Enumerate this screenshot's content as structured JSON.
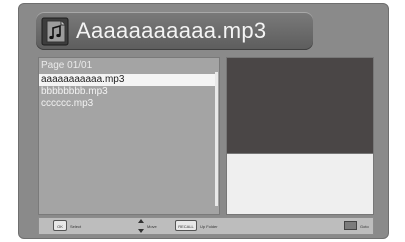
{
  "title": {
    "text": "Aaaaaaaaaaa.mp3",
    "icon": "music-file-icon"
  },
  "list": {
    "page_label": "Page 01/01",
    "items": [
      "aaaaaaaaaaa.mp3",
      "bbbbbbbb.mp3",
      "cccccc.mp3"
    ],
    "selected_index": 0
  },
  "footer": {
    "ok_key": "OK",
    "ok_label": "Select",
    "move_label": "Move",
    "recall_key": "RECALL",
    "recall_label": "Up Folder",
    "goto_label": "Goto"
  },
  "colors": {
    "screen": "#8a8a8a",
    "list_panel": "#a4a4a4",
    "selection": "#f4f4f4",
    "preview_dark": "#4a4646",
    "preview_light": "#efefef"
  }
}
